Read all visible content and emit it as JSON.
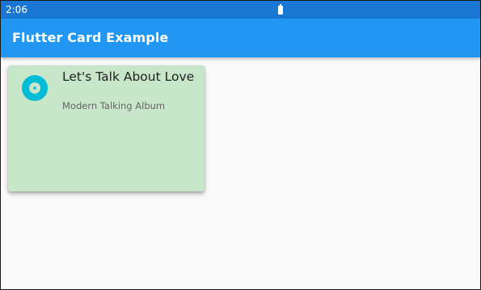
{
  "status_bar": {
    "time": "2:06",
    "battery_icon": "battery-icon",
    "color": "#1976d2"
  },
  "app_bar": {
    "title": "Flutter Card Example",
    "color": "#2196f3"
  },
  "card": {
    "leading_icon": "album-icon",
    "icon_color": "#00bcd4",
    "title": "Let's Talk About Love",
    "subtitle": "Modern Talking Album",
    "background": "#c8e6c9"
  }
}
